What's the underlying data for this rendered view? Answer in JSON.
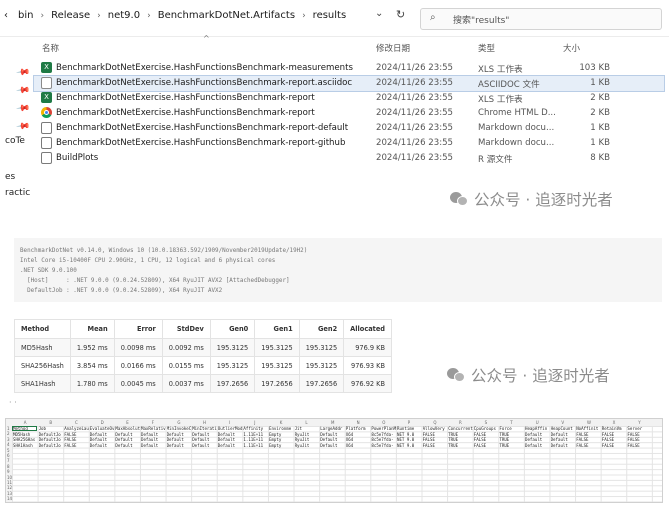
{
  "explorer": {
    "breadcrumbs": [
      "bin",
      "Release",
      "net9.0",
      "BenchmarkDotNet.Artifacts",
      "results"
    ],
    "dropdown_icon": "chevron-down-icon",
    "refresh_icon": "refresh-icon",
    "search_placeholder": "搜索\"results\"",
    "columns": {
      "name": "名称",
      "date": "修改日期",
      "type": "类型",
      "size": "大小"
    },
    "sidebar_labels": [
      "coTe",
      "es",
      "ractic"
    ],
    "files": [
      {
        "name": "BenchmarkDotNetExercise.HashFunctionsBenchmark-measurements",
        "date": "2024/11/26 23:55",
        "type": "XLS 工作表",
        "size": "103 KB",
        "icon": "xls-file-icon",
        "selected": false
      },
      {
        "name": "BenchmarkDotNetExercise.HashFunctionsBenchmark-report.asciidoc",
        "date": "2024/11/26 23:55",
        "type": "ASCIIDOC 文件",
        "size": "1 KB",
        "icon": "document-file-icon",
        "selected": true
      },
      {
        "name": "BenchmarkDotNetExercise.HashFunctionsBenchmark-report",
        "date": "2024/11/26 23:55",
        "type": "XLS 工作表",
        "size": "2 KB",
        "icon": "xls-file-icon",
        "selected": false
      },
      {
        "name": "BenchmarkDotNetExercise.HashFunctionsBenchmark-report",
        "date": "2024/11/26 23:55",
        "type": "Chrome HTML D...",
        "size": "2 KB",
        "icon": "chrome-icon",
        "selected": false
      },
      {
        "name": "BenchmarkDotNetExercise.HashFunctionsBenchmark-report-default",
        "date": "2024/11/26 23:55",
        "type": "Markdown docu...",
        "size": "1 KB",
        "icon": "markdown-file-icon",
        "selected": false
      },
      {
        "name": "BenchmarkDotNetExercise.HashFunctionsBenchmark-report-github",
        "date": "2024/11/26 23:55",
        "type": "Markdown docu...",
        "size": "1 KB",
        "icon": "markdown-file-icon",
        "selected": false
      },
      {
        "name": "BuildPlots",
        "date": "2024/11/26 23:55",
        "type": "R 源文件",
        "size": "8 KB",
        "icon": "r-file-icon",
        "selected": false
      }
    ]
  },
  "watermark": "公众号 · 追逐时光者",
  "environment_lines": [
    "BenchmarkDotNet v0.14.0, Windows 10 (10.0.18363.592/1909/November2019Update/19H2)",
    "Intel Core i5-10400F CPU 2.90GHz, 1 CPU, 12 logical and 6 physical cores",
    ".NET SDK 9.0.100",
    "  [Host]     : .NET 9.0.0 (9.0.24.52809), X64 RyuJIT AVX2 [AttachedDebugger]",
    "  DefaultJob : .NET 9.0.0 (9.0.24.52809), X64 RyuJIT AVX2"
  ],
  "results_table": {
    "headers": [
      "Method",
      "Mean",
      "Error",
      "StdDev",
      "Gen0",
      "Gen1",
      "Gen2",
      "Allocated"
    ],
    "rows": [
      [
        "MD5Hash",
        "1.952 ms",
        "0.0098 ms",
        "0.0092 ms",
        "195.3125",
        "195.3125",
        "195.3125",
        "976.9 KB"
      ],
      [
        "SHA256Hash",
        "3.854 ms",
        "0.0166 ms",
        "0.0155 ms",
        "195.3125",
        "195.3125",
        "195.3125",
        "976.93 KB"
      ],
      [
        "SHA1Hash",
        "1.780 ms",
        "0.0045 ms",
        "0.0037 ms",
        "197.2656",
        "197.2656",
        "197.2656",
        "976.92 KB"
      ]
    ]
  },
  "spreadsheet": {
    "col_letters": [
      "A",
      "B",
      "C",
      "D",
      "E",
      "F",
      "G",
      "H",
      "I",
      "J",
      "K",
      "L",
      "M",
      "N",
      "O",
      "P",
      "Q",
      "R",
      "S",
      "T",
      "U",
      "V",
      "W",
      "X",
      "Y"
    ],
    "row_numbers": [
      "1",
      "2",
      "3",
      "4",
      "5",
      "6",
      "7",
      "8",
      "9",
      "10",
      "11",
      "12",
      "13",
      "14"
    ],
    "header_row": [
      "Method",
      "Job",
      "AnalyzeLau",
      "EvaluateOv",
      "MaxAbsolut",
      "MaxRelativ",
      "MinInvokeC",
      "MinIterati",
      "OutlierMod",
      "Affinity",
      "Environme",
      "Jit",
      "LargeAddr",
      "Platform",
      "PowerPlanM",
      "Runtime",
      "AllowVery",
      "Concurrent",
      "CpuGroups",
      "Force",
      "HeapAffin",
      "HeapCount",
      "NoAffinit",
      "RetainVm",
      "Server"
    ],
    "rows": [
      [
        "MD5Hash",
        "DefaultJo",
        "FALSE",
        "Default",
        "Default",
        "Default",
        "Default",
        "Default",
        "Default",
        "1.11E+11",
        "Empty",
        "RyuJit",
        "Default",
        "X64",
        "8c5e7fda-",
        "NET 9.0",
        "FALSE",
        "TRUE",
        "FALSE",
        "TRUE",
        "Default",
        "Default",
        "FALSE",
        "FALSE",
        "FALSE"
      ],
      [
        "SHA256Has",
        "DefaultJo",
        "FALSE",
        "Default",
        "Default",
        "Default",
        "Default",
        "Default",
        "Default",
        "1.11E+11",
        "Empty",
        "RyuJit",
        "Default",
        "X64",
        "8c5e7fda-",
        "NET 9.0",
        "FALSE",
        "TRUE",
        "FALSE",
        "TRUE",
        "Default",
        "Default",
        "FALSE",
        "FALSE",
        "FALSE"
      ],
      [
        "SHA1Hash",
        "DefaultJo",
        "FALSE",
        "Default",
        "Default",
        "Default",
        "Default",
        "Default",
        "Default",
        "1.11E+11",
        "Empty",
        "RyuJit",
        "Default",
        "X64",
        "8c5e7fda-",
        "NET 9.0",
        "FALSE",
        "TRUE",
        "FALSE",
        "TRUE",
        "Default",
        "Default",
        "FALSE",
        "FALSE",
        "FALSE"
      ]
    ]
  }
}
